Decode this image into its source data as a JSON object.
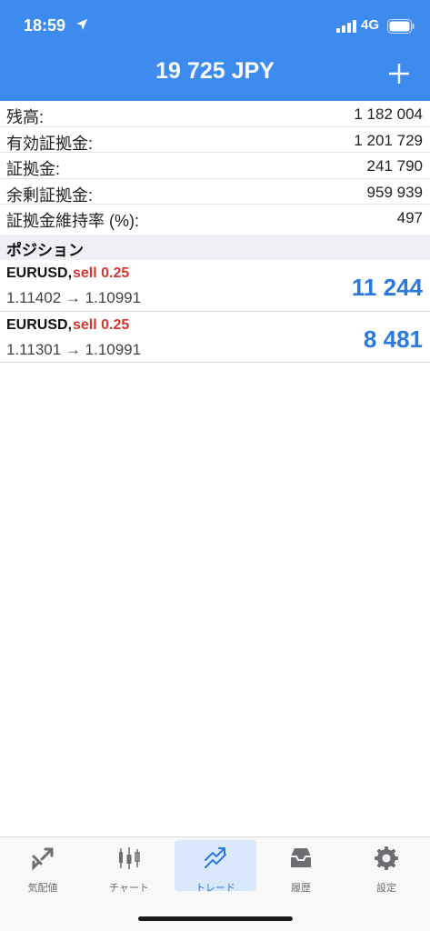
{
  "status_bar": {
    "time": "18:59",
    "network": "4G"
  },
  "header": {
    "title": "19 725 JPY"
  },
  "account": [
    {
      "label": "残高:",
      "value": "1 182 004"
    },
    {
      "label": "有効証拠金:",
      "value": "1 201 729"
    },
    {
      "label": "証拠金:",
      "value": "241 790"
    },
    {
      "label": "余剰証拠金:",
      "value": "959 939"
    },
    {
      "label": "証拠金維持率 (%):",
      "value": "497"
    }
  ],
  "positions_section": {
    "title": "ポジション"
  },
  "positions": [
    {
      "symbol": "EURUSD,",
      "side": "sell 0.25",
      "prices": "1.11402 → 1.10991",
      "profit": "11 244"
    },
    {
      "symbol": "EURUSD,",
      "side": "sell 0.25",
      "prices": "1.11301 → 1.10991",
      "profit": "8 481"
    }
  ],
  "tabs": [
    {
      "label": "気配値",
      "icon": "quotes-icon"
    },
    {
      "label": "チャート",
      "icon": "chart-icon"
    },
    {
      "label": "トレード",
      "icon": "trade-icon",
      "active": true
    },
    {
      "label": "履歴",
      "icon": "history-icon"
    },
    {
      "label": "設定",
      "icon": "settings-icon"
    }
  ],
  "colors": {
    "header": "#3d8bef",
    "sell": "#d2382f",
    "profit": "#2a79e0",
    "active_tab": "#2a79e0",
    "inactive_tab": "#6d6d72"
  }
}
